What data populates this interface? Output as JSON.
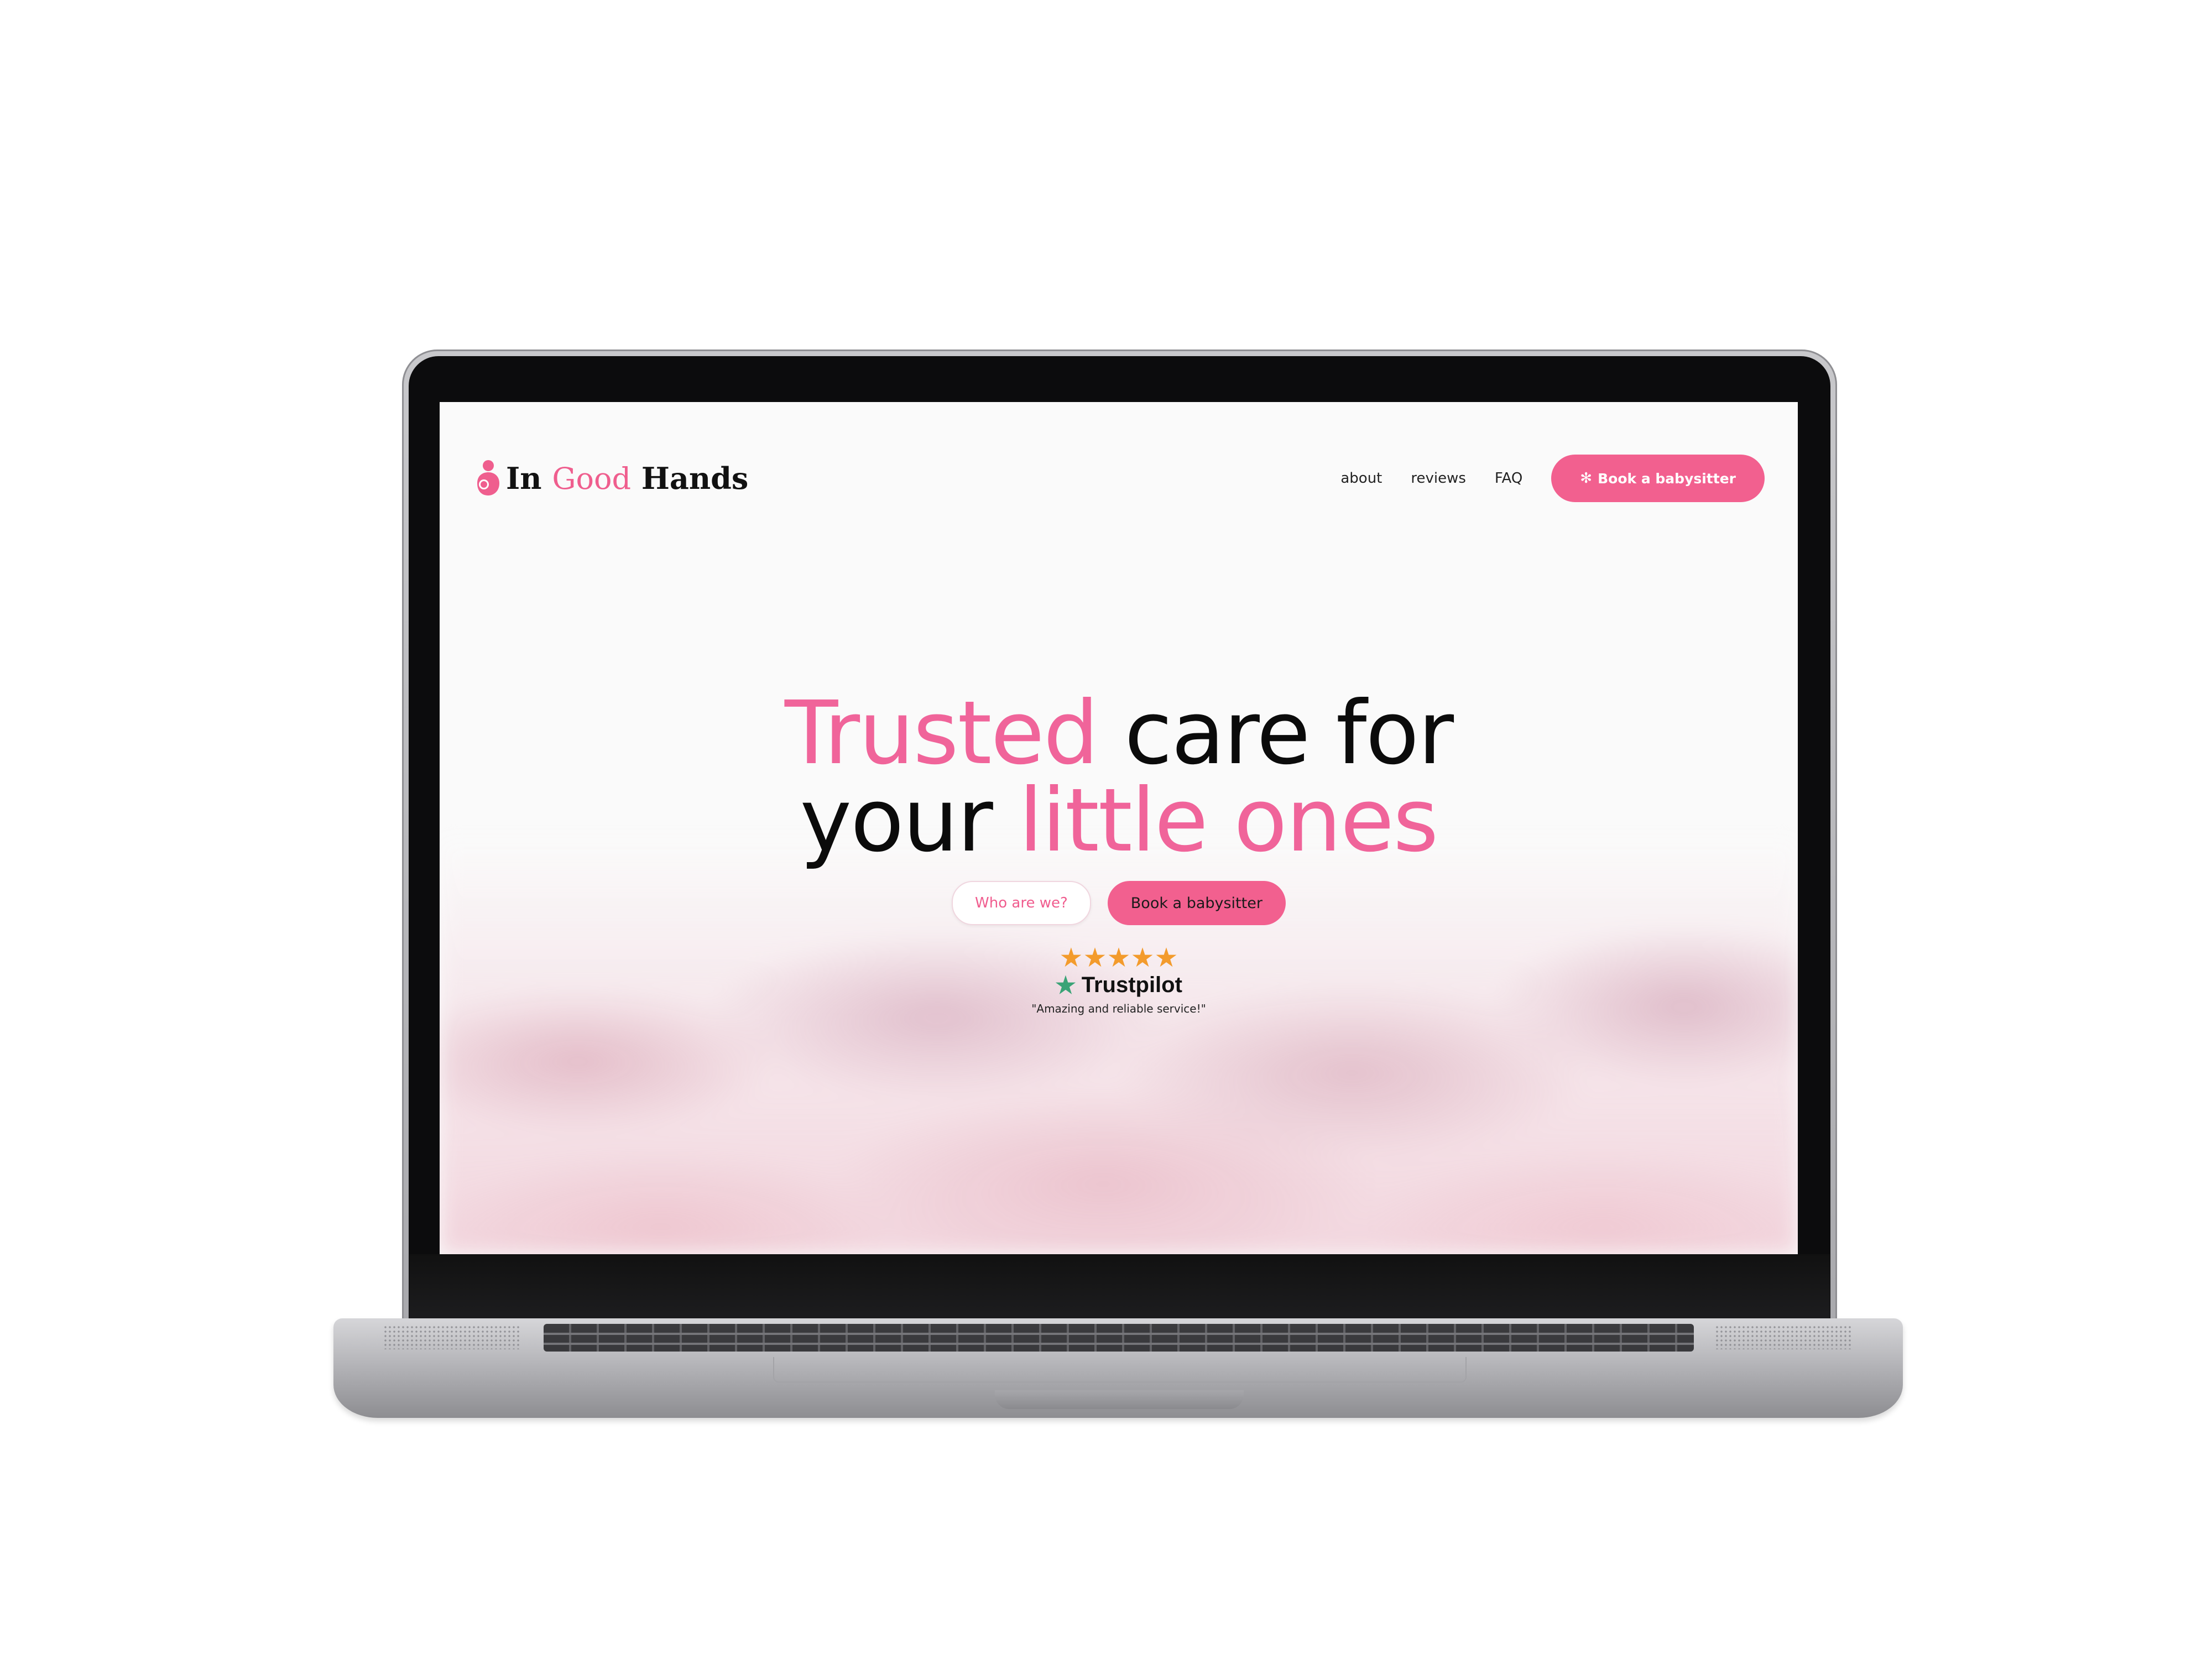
{
  "brand": {
    "name_part1": "In",
    "name_part2": "Good",
    "name_part3": "Hands",
    "accent_color": "#f2608f",
    "logo_icon": "mother-child-icon"
  },
  "nav": {
    "links": [
      "about",
      "reviews",
      "FAQ"
    ],
    "cta_label": "Book a babysitter",
    "cta_icon": "person-icon"
  },
  "hero": {
    "line1_accent": "Trusted",
    "line1_rest": " care for",
    "line2_start": "your ",
    "line2_accent": "little ones"
  },
  "buttons": {
    "secondary_label": "Who are we?",
    "primary_label": "Book a babysitter"
  },
  "rating": {
    "stars": "★★★★★",
    "stars_value": 5,
    "stars_max": 5,
    "provider": "Trustpilot",
    "quote": "\"Amazing and reliable service!\""
  }
}
